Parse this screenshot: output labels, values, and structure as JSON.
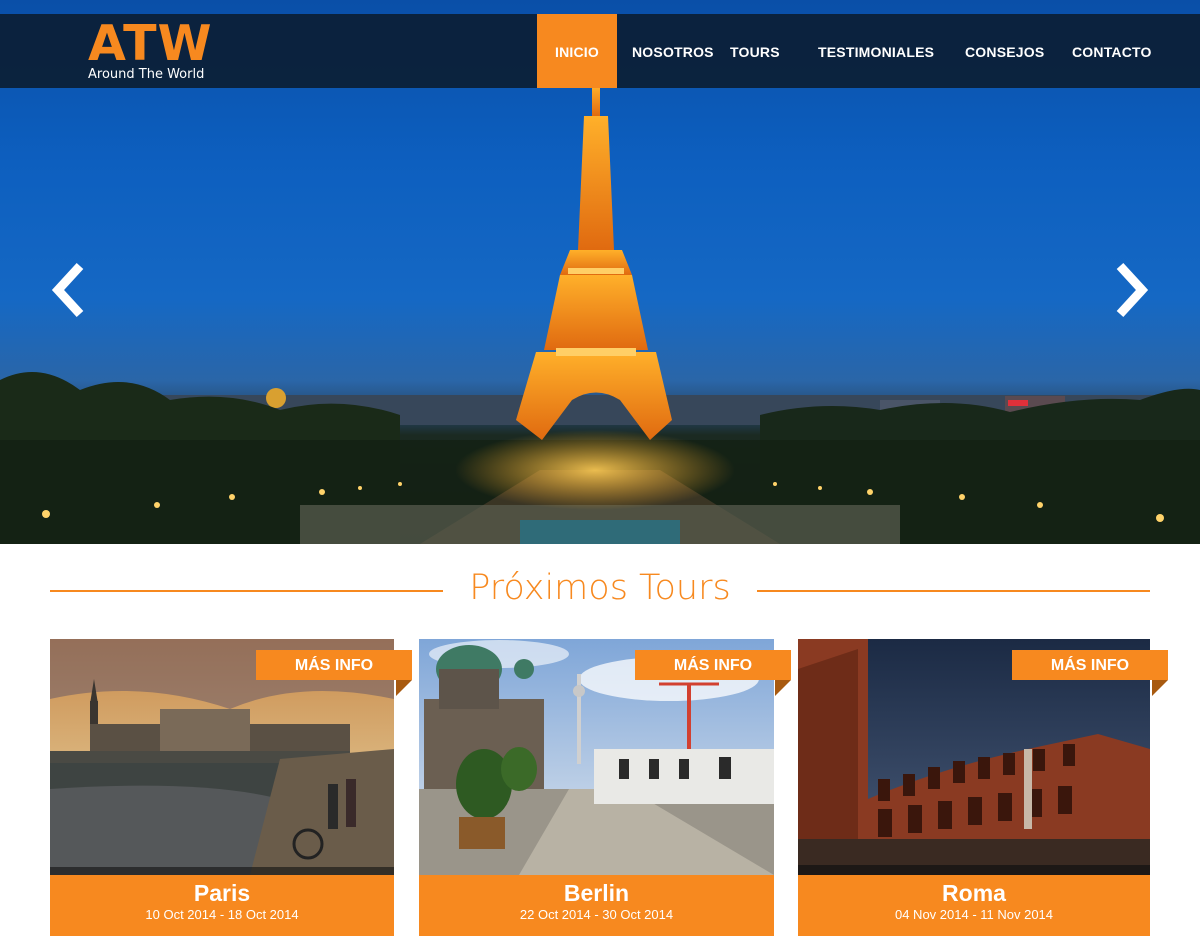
{
  "brand": {
    "logo_mark": "ATW",
    "logo_tagline": "Around The World",
    "accent": "#f7891f"
  },
  "nav": {
    "items": [
      {
        "label": "INICIO",
        "active": true
      },
      {
        "label": "NOSOTROS",
        "active": false
      },
      {
        "label": "TOURS",
        "active": false
      },
      {
        "label": "TESTIMONIALES",
        "active": false
      },
      {
        "label": "CONSEJOS",
        "active": false
      },
      {
        "label": "CONTACTO",
        "active": false
      }
    ]
  },
  "hero": {
    "prev_icon": "chevron-left-icon",
    "next_icon": "chevron-right-icon",
    "image": "eiffel-tower-night-photo"
  },
  "section": {
    "title": "Próximos Tours"
  },
  "tours": [
    {
      "city": "Paris",
      "dates": "10 Oct 2014 - 18 Oct 2014",
      "more_label": "MÁS INFO",
      "image": "paris-seine-photo"
    },
    {
      "city": "Berlin",
      "dates": "22 Oct 2014 - 30 Oct 2014",
      "more_label": "MÁS INFO",
      "image": "berlin-cathedral-photo"
    },
    {
      "city": "Roma",
      "dates": "04 Nov 2014 - 11 Nov 2014",
      "more_label": "MÁS INFO",
      "image": "rome-trajan-market-photo"
    }
  ]
}
